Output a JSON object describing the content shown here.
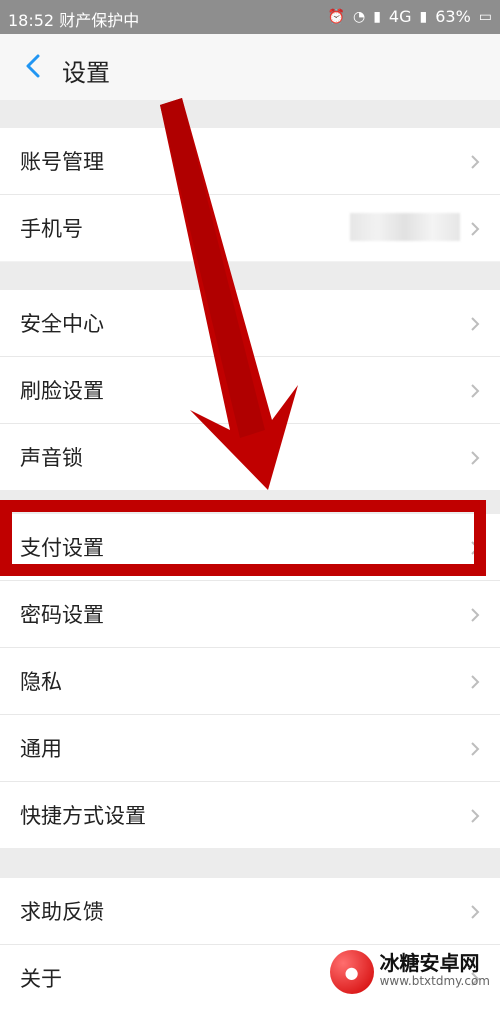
{
  "status": {
    "time": "18:52",
    "carrier": "财产保护中",
    "network": "4G",
    "battery": "63%"
  },
  "header": {
    "title": "设置"
  },
  "groups": [
    {
      "items": [
        {
          "label": "账号管理"
        },
        {
          "label": "手机号"
        }
      ]
    },
    {
      "items": [
        {
          "label": "安全中心"
        },
        {
          "label": "刷脸设置"
        },
        {
          "label": "声音锁"
        }
      ]
    },
    {
      "items": [
        {
          "label": "支付设置"
        },
        {
          "label": "密码设置"
        },
        {
          "label": "隐私"
        },
        {
          "label": "通用"
        },
        {
          "label": "快捷方式设置"
        }
      ]
    },
    {
      "items": [
        {
          "label": "求助反馈"
        },
        {
          "label": "关于"
        }
      ]
    }
  ],
  "watermark": {
    "name": "冰糖安卓网",
    "url": "www.btxtdmy.com"
  },
  "colors": {
    "annotation": "#c00000",
    "accent": "#2196f3"
  }
}
